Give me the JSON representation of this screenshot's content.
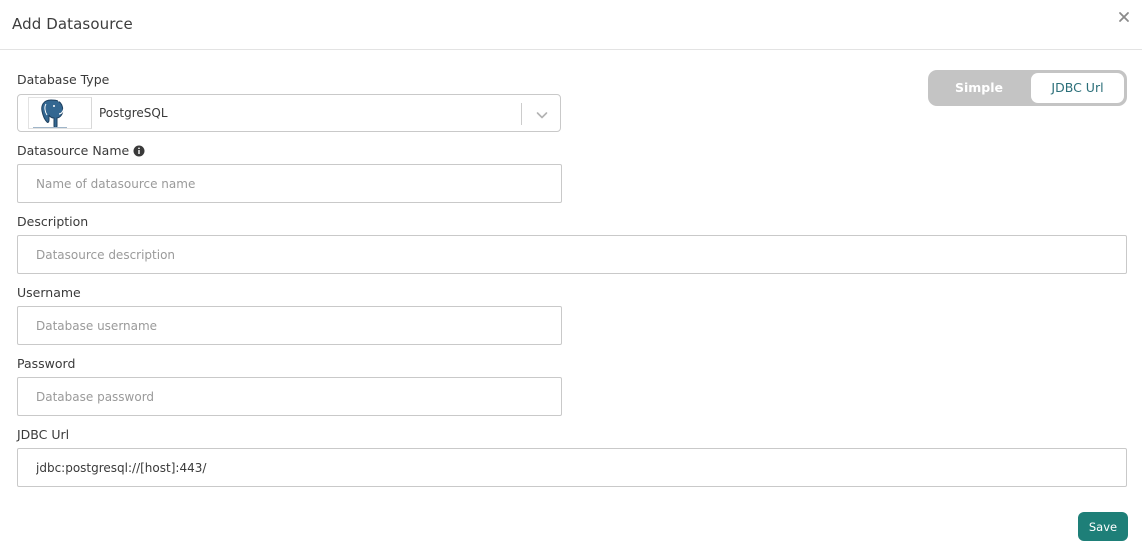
{
  "modal": {
    "title": "Add Datasource",
    "close_icon": "close-icon"
  },
  "mode_toggle": {
    "options": [
      "Simple",
      "JDBC Url"
    ],
    "selected": "JDBC Url"
  },
  "fields": {
    "database_type": {
      "label": "Database Type",
      "value": "PostgreSQL",
      "logo_icon": "postgresql-elephant-icon",
      "dropdown_icon": "chevron-down-icon"
    },
    "datasource_name": {
      "label": "Datasource Name",
      "info_icon": "info-icon",
      "placeholder": "Name of datasource name",
      "value": ""
    },
    "description": {
      "label": "Description",
      "placeholder": "Datasource description",
      "value": ""
    },
    "username": {
      "label": "Username",
      "placeholder": "Database username",
      "value": ""
    },
    "password": {
      "label": "Password",
      "placeholder": "Database password",
      "value": ""
    },
    "jdbc_url": {
      "label": "JDBC Url",
      "value": "jdbc:postgresql://[host]:443/"
    }
  },
  "actions": {
    "save_label": "Save"
  },
  "colors": {
    "accent": "#1e7f78",
    "toggle_track": "#c4c4c4",
    "toggle_selected_text": "#2b6f79"
  }
}
